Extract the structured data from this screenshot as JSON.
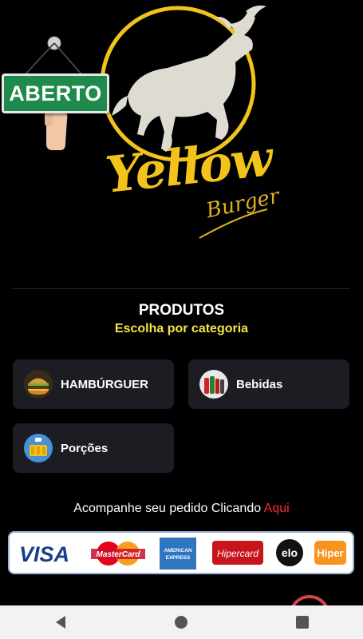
{
  "brand": {
    "name": "Yellow",
    "sub": "Burger",
    "color": "#f2c31b"
  },
  "status_sign": {
    "text": "ABERTO",
    "color": "#1e8a4b"
  },
  "products": {
    "title": "PRODUTOS",
    "subtitle": "Escolha por categoria",
    "subtitle_color": "#f1e646"
  },
  "categories": [
    {
      "label": "HAMBÚRGUER",
      "icon": "burger-icon"
    },
    {
      "label": "Bebidas",
      "icon": "drinks-icon"
    },
    {
      "label": "Porções",
      "icon": "fries-icon"
    }
  ],
  "tracking": {
    "text": "Acompanhe seu pedido Clicando",
    "link": "Aqui",
    "link_color": "#ff2a2a"
  },
  "payment_methods": [
    "VISA",
    "MasterCard",
    "AMERICAN EXPRESS",
    "Hipercard",
    "elo",
    "Hiper"
  ],
  "nav": {
    "back": "back-icon",
    "home": "home-icon",
    "recents": "recents-icon"
  }
}
